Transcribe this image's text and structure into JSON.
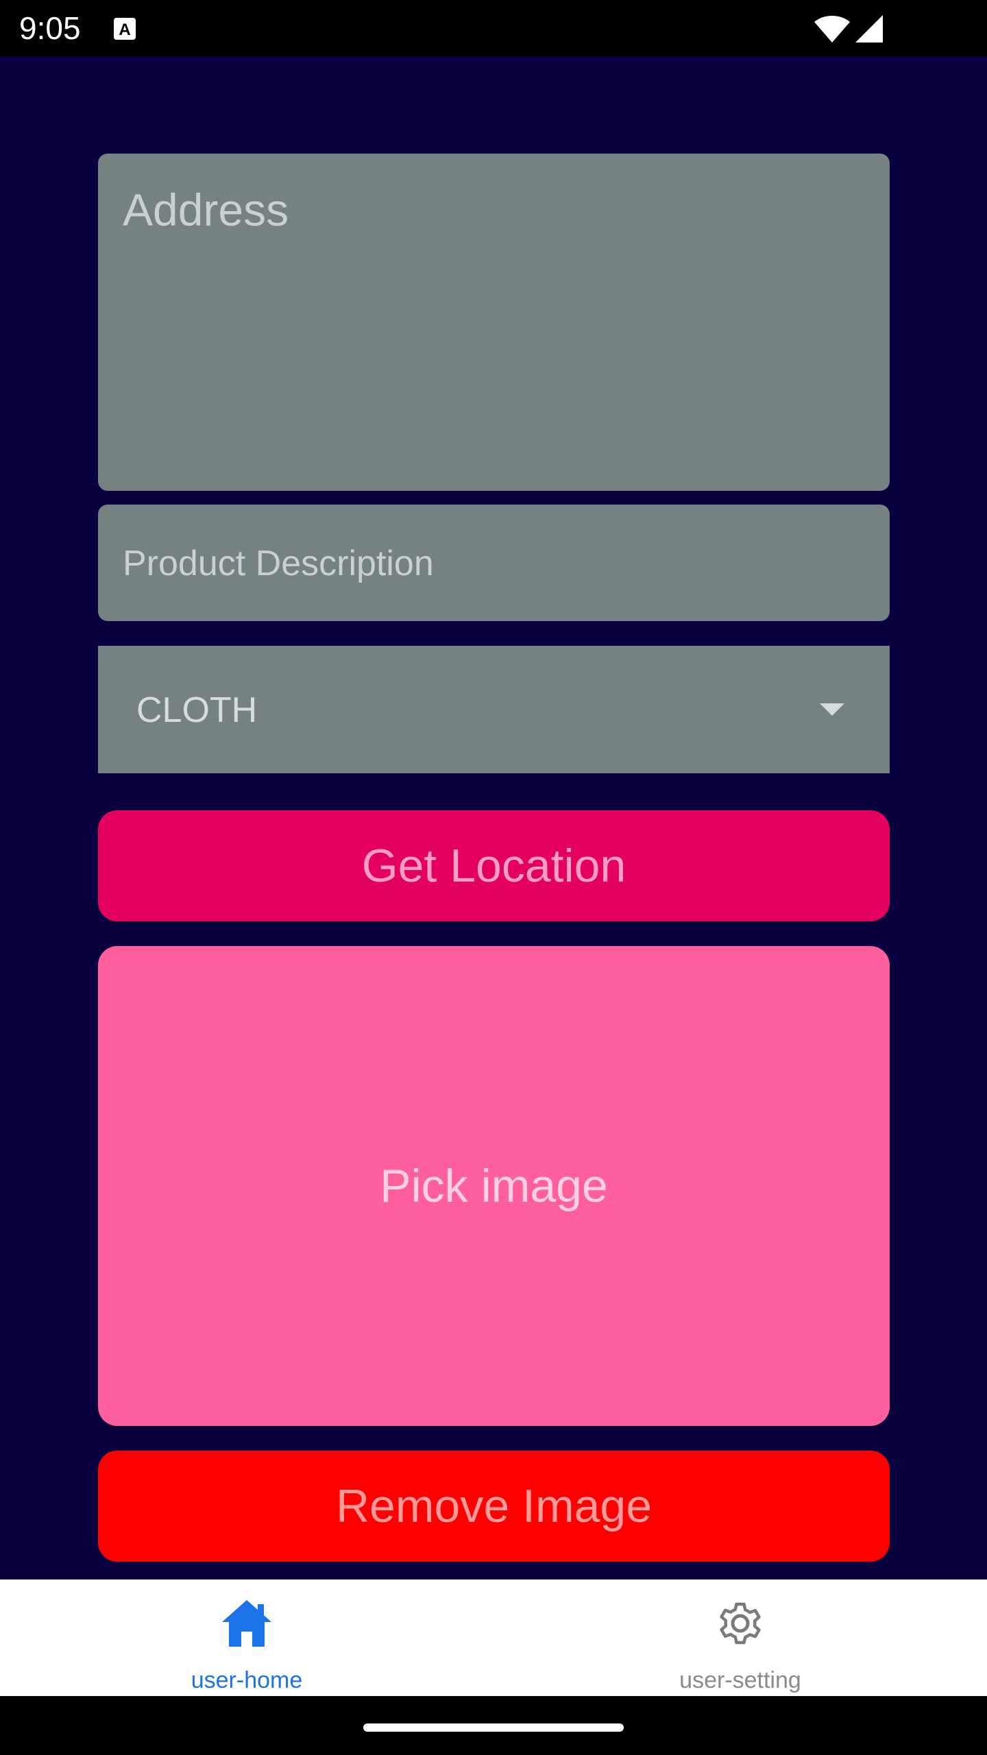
{
  "status_bar": {
    "time": "9:05",
    "icons": [
      "a-notification-icon",
      "wifi-icon",
      "cell-signal-icon"
    ]
  },
  "form": {
    "address_placeholder": "Address",
    "description_placeholder": "Product Description",
    "category_selected": "CLOTH"
  },
  "buttons": {
    "get_location": "Get Location",
    "pick_image": "Pick image",
    "remove_image": "Remove Image"
  },
  "bottom_nav": {
    "items": [
      {
        "label": "user-home",
        "icon": "home-icon",
        "active": true
      },
      {
        "label": "user-setting",
        "icon": "gear-icon",
        "active": false
      }
    ]
  },
  "colors": {
    "background": "#08003f",
    "field": "#768281",
    "get_location_button": "#e3005f",
    "pick_image_button": "#ff609d",
    "remove_image_button": "#ff0000",
    "nav_active": "#1a73e8",
    "nav_inactive": "#8a8a8a"
  }
}
